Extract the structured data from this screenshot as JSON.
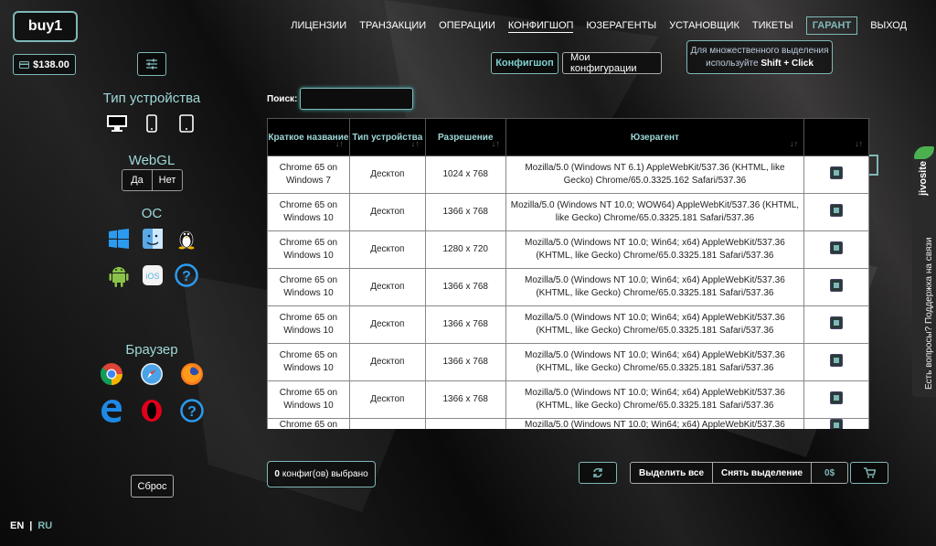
{
  "logo": "buy1",
  "balance": "$138.00",
  "nav": [
    "ЛИЦЕНЗИИ",
    "ТРАНЗАКЦИИ",
    "ОПЕРАЦИИ",
    "КОНФИГШОП",
    "ЮЗЕРАГЕНТЫ",
    "УСТАНОВЩИК",
    "ТИКЕТЫ",
    "ГАРАНТ",
    "ВЫХОД"
  ],
  "tabs": {
    "configshop": "Конфигшоп",
    "myconfigs": "Мои конфигурации"
  },
  "hint": {
    "line1": "Для множественного выделения",
    "line2a": "используйте ",
    "line2b": "Shift + Click"
  },
  "filters": {
    "device_title": "Тип устройства",
    "webgl_title": "WebGL",
    "webgl_yes": "Да",
    "webgl_no": "Нет",
    "os_title": "ОС",
    "browser_title": "Браузер",
    "reset": "Сброс"
  },
  "lang": {
    "en": "EN",
    "sep": "|",
    "ru": "RU"
  },
  "search": {
    "label": "Поиск:",
    "placeholder": ""
  },
  "table": {
    "headers": [
      "Краткое название",
      "Тип устройства",
      "Разрешение",
      "Юзерагент",
      ""
    ],
    "rows": [
      [
        "Chrome 65 on Windows 7",
        "Десктоп",
        "1024 x 768",
        "Mozilla/5.0 (Windows NT 6.1) AppleWebKit/537.36 (KHTML, like Gecko) Chrome/65.0.3325.162 Safari/537.36"
      ],
      [
        "Chrome 65 on Windows 10",
        "Десктоп",
        "1366 x 768",
        "Mozilla/5.0 (Windows NT 10.0; WOW64) AppleWebKit/537.36 (KHTML, like Gecko) Chrome/65.0.3325.181 Safari/537.36"
      ],
      [
        "Chrome 65 on Windows 10",
        "Десктоп",
        "1280 x 720",
        "Mozilla/5.0 (Windows NT 10.0; Win64; x64) AppleWebKit/537.36 (KHTML, like Gecko) Chrome/65.0.3325.181 Safari/537.36"
      ],
      [
        "Chrome 65 on Windows 10",
        "Десктоп",
        "1366 x 768",
        "Mozilla/5.0 (Windows NT 10.0; Win64; x64) AppleWebKit/537.36 (KHTML, like Gecko) Chrome/65.0.3325.181 Safari/537.36"
      ],
      [
        "Chrome 65 on Windows 10",
        "Десктоп",
        "1366 x 768",
        "Mozilla/5.0 (Windows NT 10.0; Win64; x64) AppleWebKit/537.36 (KHTML, like Gecko) Chrome/65.0.3325.181 Safari/537.36"
      ],
      [
        "Chrome 65 on Windows 10",
        "Десктоп",
        "1366 x 768",
        "Mozilla/5.0 (Windows NT 10.0; Win64; x64) AppleWebKit/537.36 (KHTML, like Gecko) Chrome/65.0.3325.181 Safari/537.36"
      ],
      [
        "Chrome 65 on Windows 10",
        "Десктоп",
        "1366 x 768",
        "Mozilla/5.0 (Windows NT 10.0; Win64; x64) AppleWebKit/537.36 (KHTML, like Gecko) Chrome/65.0.3325.181 Safari/537.36"
      ],
      [
        "Chrome 65 on",
        "",
        "",
        "Mozilla/5.0 (Windows NT 10.0; Win64; x64) AppleWebKit/537.36"
      ]
    ]
  },
  "footer": {
    "selected_count": "0",
    "selected_text": "конфиг(ов) выбрано",
    "select_all": "Выделить все",
    "deselect": "Снять выделение",
    "sum": "0$"
  },
  "jivo": {
    "brand": "jivosite",
    "text": "Есть вопросы? Поддержка на связи"
  },
  "colors": {
    "accent": "#7fb8b8",
    "header_bg": "#000000"
  }
}
